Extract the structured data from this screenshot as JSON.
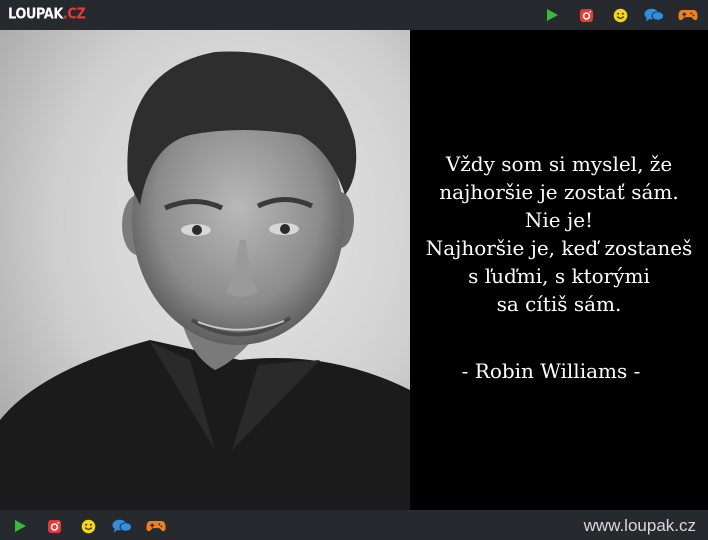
{
  "header": {
    "logo_main": "LOUPAK",
    "logo_suffix": "CZ",
    "icons": [
      "play-icon",
      "instagram-icon",
      "smiley-icon",
      "chat-icon",
      "gamepad-icon"
    ]
  },
  "quote": {
    "lines": [
      "Vždy som si myslel, že",
      "najhoršie je zostať sám.",
      "Nie je!",
      "Najhoršie je, keď zostaneš",
      "s ľuďmi, s ktorými",
      "sa cítiš sám."
    ],
    "author": "- Robin Williams -"
  },
  "footer": {
    "url": "www.loupak.cz",
    "icons": [
      "play-icon",
      "instagram-icon",
      "smiley-icon",
      "chat-icon",
      "gamepad-icon"
    ]
  },
  "colors": {
    "bar_background": "#262a2e",
    "play": "#3cb93c",
    "instagram": "#e53935",
    "smiley": "#f5d516",
    "chat": "#2f8fde",
    "gamepad": "#f07f1f"
  }
}
